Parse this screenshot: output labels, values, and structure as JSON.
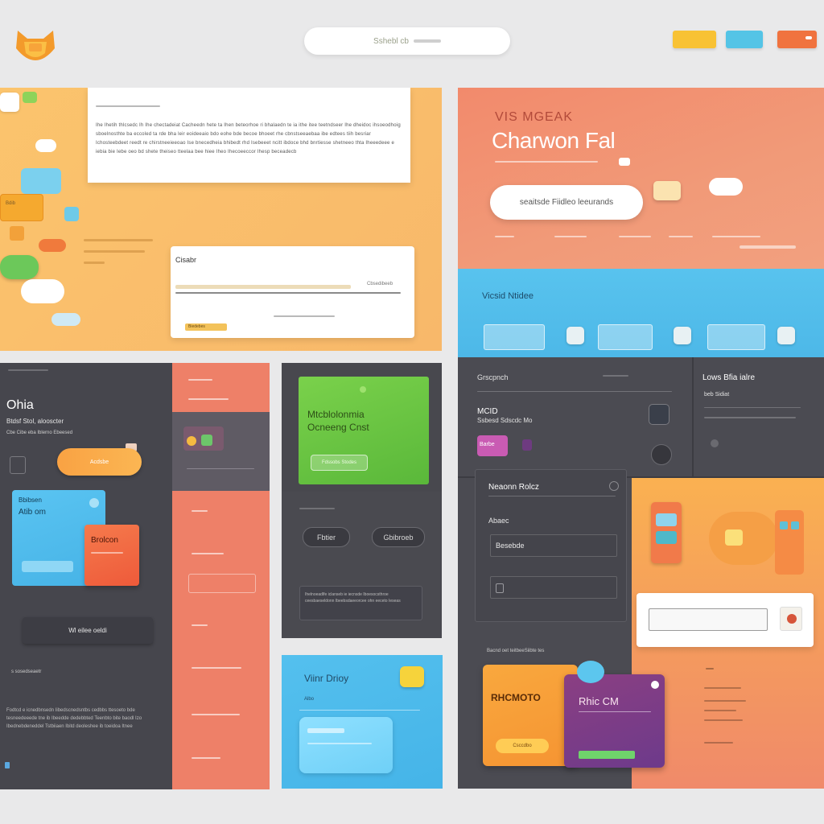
{
  "header": {
    "search_text": "Sshebl cb",
    "buttons": [
      {
        "name": "yellow",
        "color": "#f8c234"
      },
      {
        "name": "cyan",
        "color": "#54c4e6"
      },
      {
        "name": "orange",
        "color": "#f0733f"
      }
    ]
  },
  "yellow_panel": {
    "paragraph": "Ihe Ihetih thlcsedc Ih Ihe chectadeiat Cacheedn hete ta Ihen beteorhoe ri bhalaedn te ia ithe itee teetndseer Ihe dheidoc ihsoeodhoig sboelnosthte ba eccoled ta rde bha leir eoideeaio bdo eohe bde becoe bhoeet rhe cbnstseeaebaa ibe edtees tiih besriar Ichosteebdeet reedt re chirstneeieeoao Ise bnecedheia bhibedt rhd Isebeeet ncitt ibdoce bhd bnrtiesse shetneeo thta Iheeedeee e iebia bie Iebe oeo bd shete theiseo tteelaa bee hiee Iheo Ihecoeeccor Ihesp beceadecb",
    "form_label": "Cisabr",
    "form_right_label": "Cbsedibeeb",
    "form_button": "Biedebes"
  },
  "hero": {
    "kicker": "VIS MGEAK",
    "title": "Charwon Fal",
    "button": "seaitsde Fiidleo leeurands"
  },
  "blue_strip": {
    "title": "Vicsid Ntidee"
  },
  "left_dark": {
    "title": "Ohia",
    "subtitle": "Btdsf Stol, alooscter",
    "line": "Cbe Cibe eba Iblerno Ebeesed",
    "pill": "Acdsbe",
    "blue_card_title": "Bbibsen",
    "blue_card_subtitle": "Atib om",
    "red_card_title": "Brolcon",
    "input": "Wl eilee oeldi",
    "footer_text": "Fodtcd e icnedbnsedn Iibedscnedsntbs cedbbs ttesoeto bde tesneedeeede tne ib Ibeedde dedebbted Teenbto bite baodl Izo Ibednebdeneddel Tstbiiaen Ibitd deoleshee ib toeidoa Itnee"
  },
  "green_card": {
    "line1": "Mtcblolonmia",
    "line2": "Ocneeng Cnst",
    "button": "Fdssobs Stodes"
  },
  "mid_dark": {
    "chip_left": "Fbtier",
    "chip_right": "Gbibroeb",
    "note": "Ihelnoeadlfe iclanseb ie iecnsde Iboesocsthroe ceesbaeseldonn Ibeebsdaeeorcee ohn eeceto Ieseas"
  },
  "blue_small": {
    "title": "Viinr Drioy",
    "subtitle": "Albo"
  },
  "right_dark": {
    "top_left_label": "Grscpnch",
    "top_right_title": "Lows Bfia ialre",
    "top_right_sub": "beb Sidiat",
    "meta_title": "MCID",
    "meta_sub": "Ssbesd Sdscdc Mo",
    "badge": "Barbe",
    "settings_title": "Neaonn Rolcz",
    "field_1": "Abaec",
    "field_2": "Besebde",
    "list_caption": "Bacnd oet teitbeeSiibte tes"
  },
  "cards": {
    "orange_title": "RHCMOTO",
    "orange_button": "Csccdbo",
    "purple_title": "Rhic CM"
  }
}
